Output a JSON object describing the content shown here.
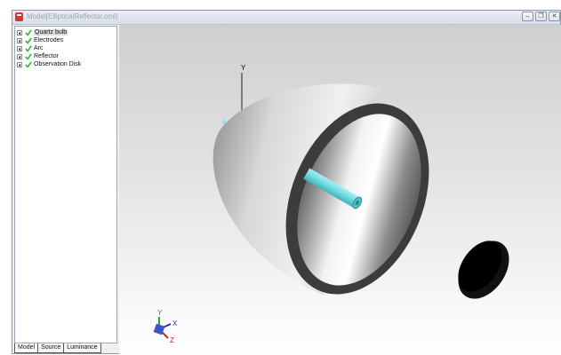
{
  "window": {
    "title": "Model[EllipticalReflector.oml]",
    "controls": [
      "minimize",
      "restore",
      "close"
    ]
  },
  "tree": {
    "items": [
      {
        "label": "Quartz bulb",
        "checked": true,
        "selected": true
      },
      {
        "label": "Electrodes",
        "checked": true,
        "selected": false
      },
      {
        "label": "Arc",
        "checked": true,
        "selected": false
      },
      {
        "label": "Reflector",
        "checked": true,
        "selected": false
      },
      {
        "label": "Observation Disk",
        "checked": true,
        "selected": false
      }
    ]
  },
  "tabs": [
    {
      "label": "Model",
      "active": true
    },
    {
      "label": "Source",
      "active": false
    },
    {
      "label": "Luminance",
      "active": false
    }
  ],
  "viewport": {
    "axis_y_label": "Y",
    "triad": {
      "x_label": "X",
      "y_label": "Y",
      "z_label": "Z"
    },
    "colors": {
      "check": "#2eb82e",
      "electrode": "#7fe6ea",
      "triad_x": "#2233aa",
      "triad_y": "#22aa33",
      "triad_z": "#cc2222"
    }
  }
}
